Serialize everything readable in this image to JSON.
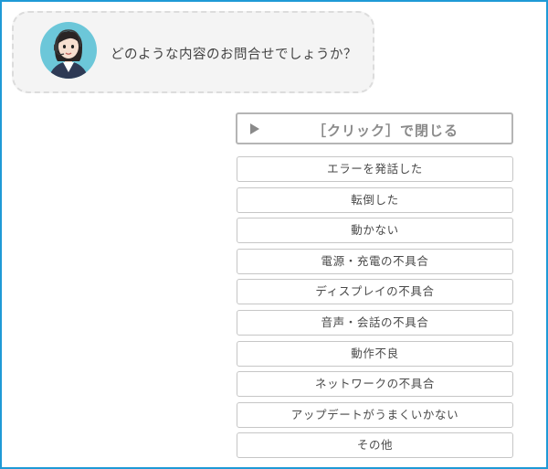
{
  "chat": {
    "question": "どのような内容のお問合せでしょうか？"
  },
  "close_button": {
    "label": "［クリック］で閉じる",
    "icon": "play-triangle-icon"
  },
  "options": [
    "エラーを発話した",
    "転倒した",
    "動かない",
    "電源・充電の不具合",
    "ディスプレイの不具合",
    "音声・会話の不具合",
    "動作不良",
    "ネットワークの不具合",
    "アップデートがうまくいかない",
    "その他"
  ],
  "colors": {
    "frame_border": "#1f9ad6",
    "bubble_bg": "#f4f4f4",
    "avatar_bg": "#6cc7d9"
  }
}
